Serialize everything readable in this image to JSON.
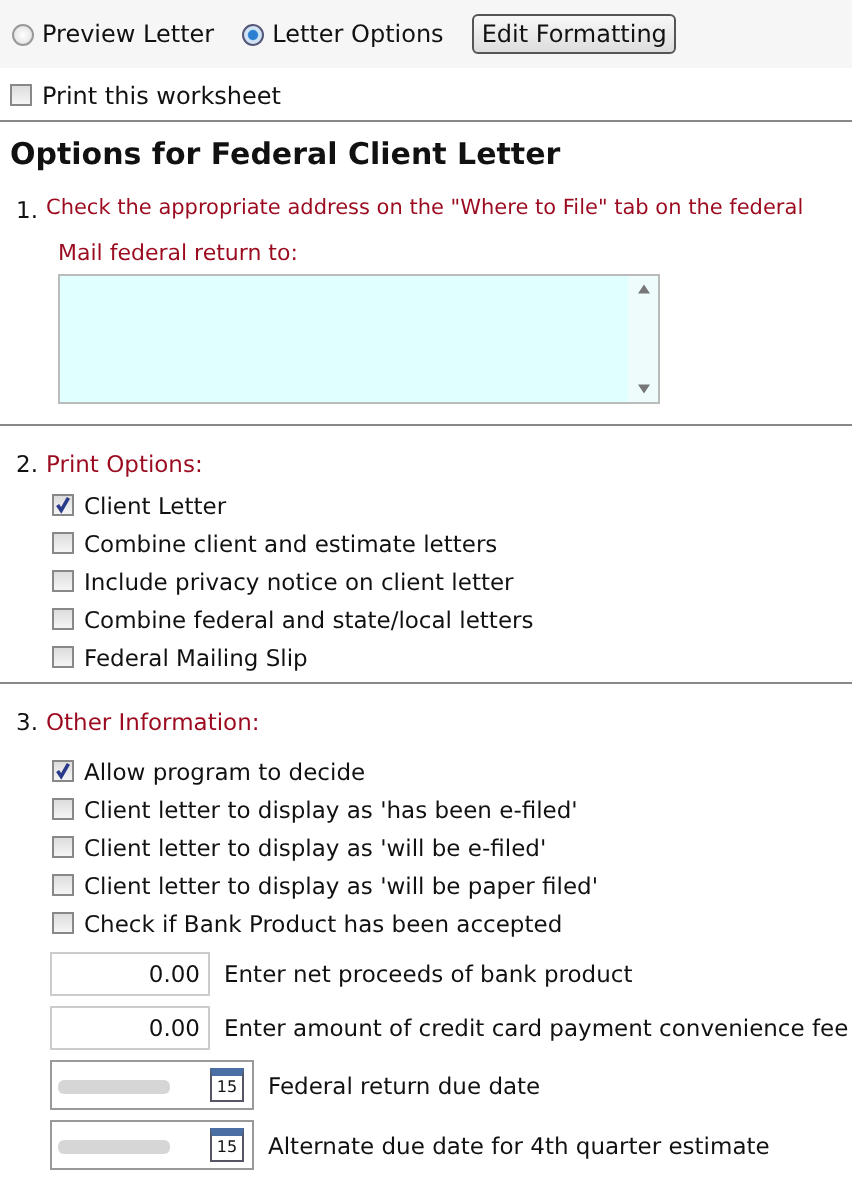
{
  "view_options": [
    {
      "label": "Preview Letter",
      "selected": false
    },
    {
      "label": "Letter Options",
      "selected": true
    }
  ],
  "edit_button": "Edit Formatting",
  "print_worksheet": {
    "label": "Print this worksheet",
    "checked": false
  },
  "title": "Options for Federal Client Letter",
  "section_1": {
    "number": "1.",
    "heading": "Check the appropriate address on the \"Where to File\" tab on the federal",
    "field_label": "Mail federal return to:"
  },
  "section_2": {
    "number": "2.",
    "heading": "Print Options:",
    "options": [
      {
        "label": "Client Letter",
        "checked": true
      },
      {
        "label": "Combine client and estimate letters",
        "checked": false
      },
      {
        "label": "Include privacy notice on client letter",
        "checked": false
      },
      {
        "label": "Combine federal and state/local letters",
        "checked": false
      },
      {
        "label": "Federal Mailing Slip",
        "checked": false
      }
    ]
  },
  "section_3": {
    "number": "3.",
    "heading": "Other Information:",
    "options": [
      {
        "label": "Allow program to decide",
        "checked": true
      },
      {
        "label": "Client letter to display as 'has been e-filed'",
        "checked": false
      },
      {
        "label": "Client letter to display as 'will be e-filed'",
        "checked": false
      },
      {
        "label": "Client letter to display as 'will be paper filed'",
        "checked": false
      },
      {
        "label": "Check if Bank Product has been accepted",
        "checked": false
      }
    ],
    "amounts": [
      {
        "value": "0.00",
        "label": "Enter net proceeds of bank product"
      },
      {
        "value": "0.00",
        "label": "Enter amount of credit card payment convenience fee"
      }
    ],
    "dates": [
      {
        "day_icon": "15",
        "label": "Federal return due date"
      },
      {
        "day_icon": "15",
        "label": "Alternate due date for 4th quarter estimate"
      }
    ]
  }
}
